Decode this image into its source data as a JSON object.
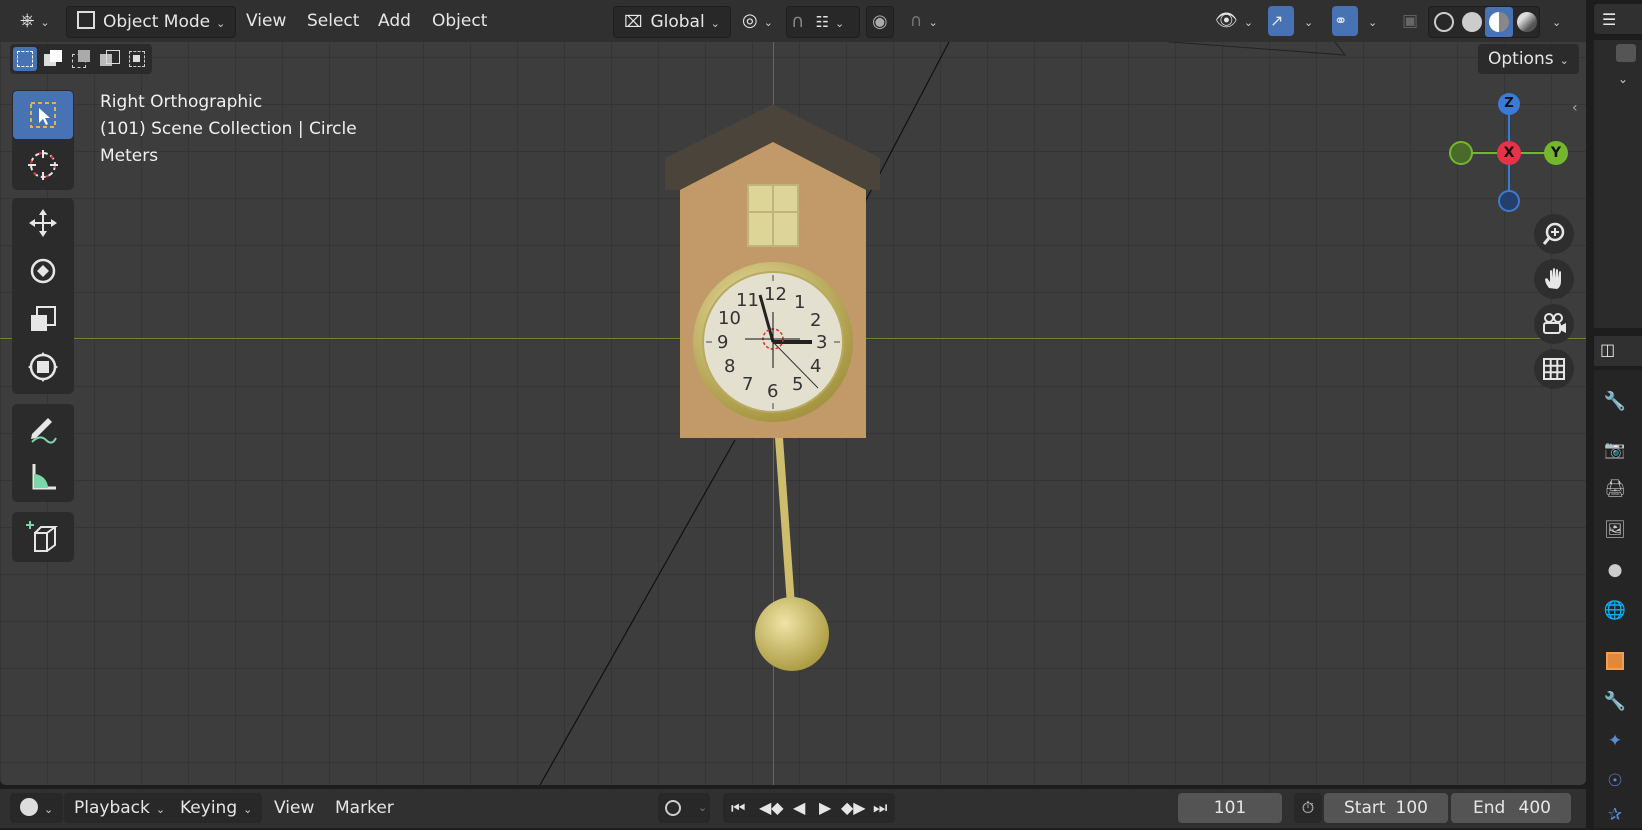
{
  "header": {
    "mode": "Object Mode",
    "menus": [
      "View",
      "Select",
      "Add",
      "Object"
    ],
    "orientation": "Global",
    "options_label": "Options"
  },
  "viewport": {
    "view_name": "Right Orthographic",
    "collection": "(101) Scene Collection | Circle",
    "units": "Meters"
  },
  "gizmo": {
    "z": "Z",
    "x": "X",
    "y": "Y"
  },
  "clock": {
    "numbers": [
      "12",
      "1",
      "2",
      "3",
      "4",
      "5",
      "6",
      "7",
      "8",
      "9",
      "10",
      "11"
    ]
  },
  "timeline": {
    "playback": "Playback",
    "keying": "Keying",
    "view": "View",
    "marker": "Marker",
    "current_frame": "101",
    "start_label": "Start",
    "start_value": "100",
    "end_label": "End",
    "end_value": "400"
  },
  "colors": {
    "accent": "#4772b3",
    "axis_x": "#e83248",
    "axis_y": "#75b72c",
    "axis_z": "#3b7ad6",
    "house": "#c29a6a",
    "roof": "#4b443b",
    "brass": "#cdbd6c"
  }
}
